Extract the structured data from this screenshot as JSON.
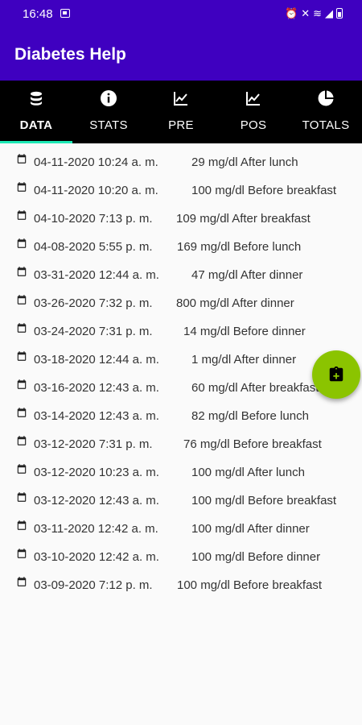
{
  "status_bar": {
    "time": "16:48"
  },
  "app": {
    "title": "Diabetes Help"
  },
  "tabs": [
    {
      "label": "DATA",
      "icon": "database-icon"
    },
    {
      "label": "STATS",
      "icon": "info-icon"
    },
    {
      "label": "PRE",
      "icon": "line-chart-icon"
    },
    {
      "label": "POS",
      "icon": "line-chart-icon"
    },
    {
      "label": "TOTALS",
      "icon": "pie-chart-icon"
    }
  ],
  "records": [
    {
      "date": "04-11-2020 10:24 a. m.",
      "value": "29 mg/dl After lunch"
    },
    {
      "date": "04-11-2020 10:20 a. m.",
      "value": "100 mg/dl Before breakfast"
    },
    {
      "date": "04-10-2020 7:13 p. m.",
      "value": "109 mg/dl After breakfast"
    },
    {
      "date": "04-08-2020 5:55 p. m.",
      "value": "169 mg/dl Before lunch"
    },
    {
      "date": "03-31-2020 12:44 a. m.",
      "value": "47 mg/dl After dinner"
    },
    {
      "date": "03-26-2020 7:32 p. m.",
      "value": "800 mg/dl After dinner"
    },
    {
      "date": "03-24-2020 7:31 p. m.",
      "value": "14 mg/dl Before dinner"
    },
    {
      "date": "03-18-2020 12:44 a. m.",
      "value": "1 mg/dl After dinner"
    },
    {
      "date": "03-16-2020 12:43 a. m.",
      "value": "60 mg/dl After breakfast"
    },
    {
      "date": "03-14-2020 12:43 a. m.",
      "value": "82 mg/dl Before lunch"
    },
    {
      "date": "03-12-2020 7:31 p. m.",
      "value": "76 mg/dl Before breakfast"
    },
    {
      "date": "03-12-2020 10:23 a. m.",
      "value": "100 mg/dl After lunch"
    },
    {
      "date": "03-12-2020 12:43 a. m.",
      "value": "100 mg/dl Before breakfast"
    },
    {
      "date": "03-11-2020 12:42 a. m.",
      "value": "100 mg/dl After dinner"
    },
    {
      "date": "03-10-2020 12:42 a. m.",
      "value": "100 mg/dl Before dinner"
    },
    {
      "date": "03-09-2020 7:12 p. m.",
      "value": "100 mg/dl Before breakfast"
    }
  ],
  "colors": {
    "app_bar": "#3f00c0",
    "tab_bar": "#000000",
    "indicator": "#1de9b6",
    "fab": "#8bc400"
  },
  "fab": {
    "icon": "add-clipboard-icon"
  }
}
